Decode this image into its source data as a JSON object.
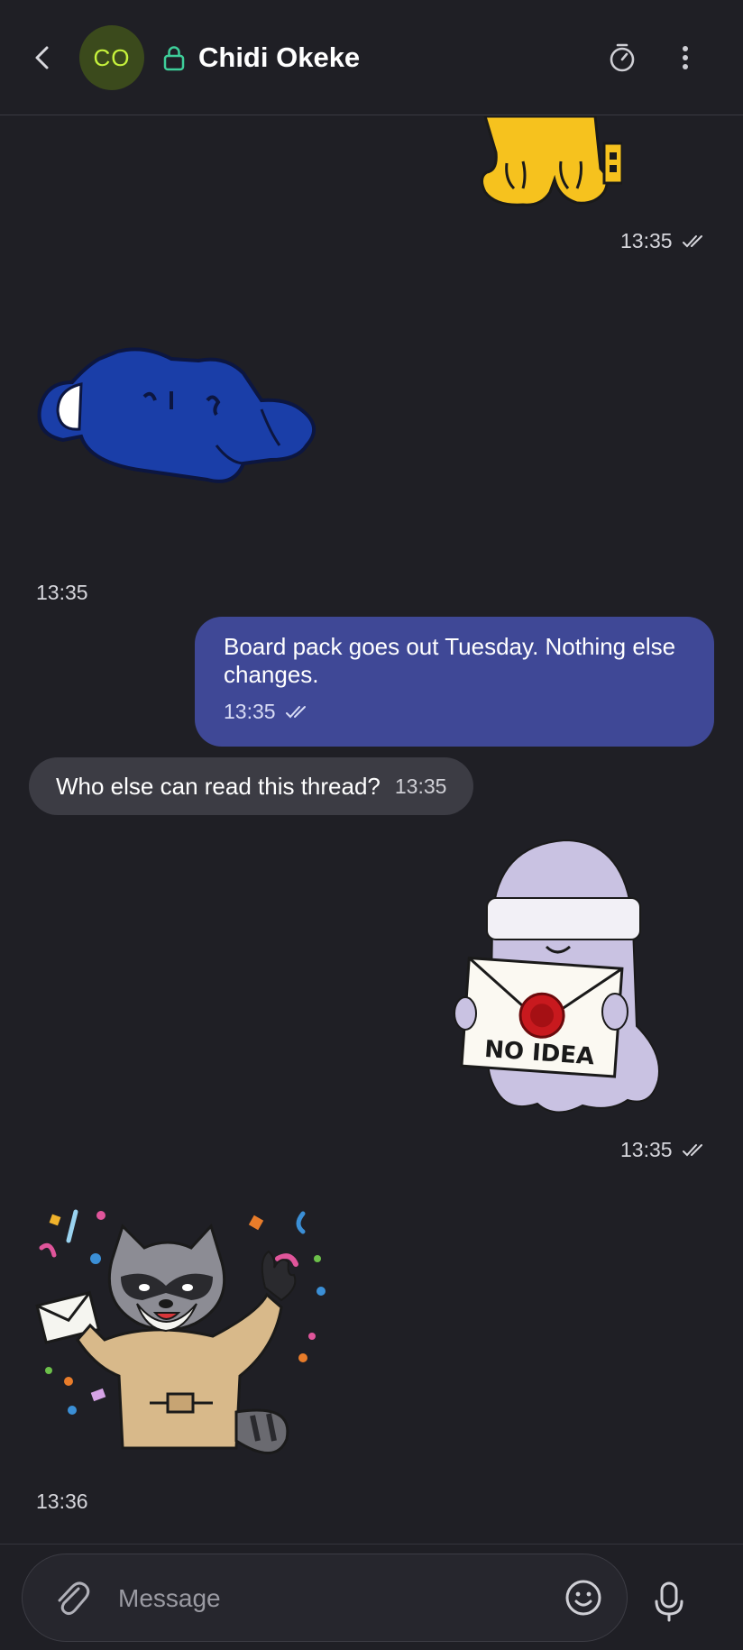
{
  "header": {
    "avatar_initials": "CO",
    "contact_name": "Chidi Okeke",
    "icons": {
      "back": "back-arrow-icon",
      "lock": "lock-icon",
      "timer": "disappearing-timer-icon",
      "menu": "more-vert-icon"
    }
  },
  "messages": [
    {
      "type": "sticker",
      "direction": "outgoing",
      "sticker": "yellow-creature-sticker",
      "time": "13:35",
      "status": "read"
    },
    {
      "type": "sticker",
      "direction": "incoming",
      "sticker": "blue-lock-lying-sticker",
      "time": "13:35"
    },
    {
      "type": "text",
      "direction": "outgoing",
      "text": "Board pack goes out Tuesday. Nothing else changes.",
      "time": "13:35",
      "status": "read"
    },
    {
      "type": "text",
      "direction": "incoming",
      "text": "Who else can read this thread?",
      "time": "13:35"
    },
    {
      "type": "sticker",
      "direction": "outgoing",
      "sticker": "ghost-no-idea-sticker",
      "sticker_text": "NO IDEA",
      "time": "13:35",
      "status": "read"
    },
    {
      "type": "sticker",
      "direction": "incoming",
      "sticker": "raccoon-envelope-sticker",
      "time": "13:36"
    }
  ],
  "composer": {
    "placeholder": "Message",
    "value": "",
    "icons": {
      "attach": "paperclip-icon",
      "emoji": "emoji-icon",
      "mic": "microphone-icon"
    }
  },
  "colors": {
    "background": "#1f1f25",
    "outgoing_bubble": "#3f4896",
    "incoming_bubble": "#3c3c44",
    "avatar_bg": "#3b4a1c",
    "avatar_text": "#c6f23c",
    "lock_green": "#3ecf9a"
  }
}
